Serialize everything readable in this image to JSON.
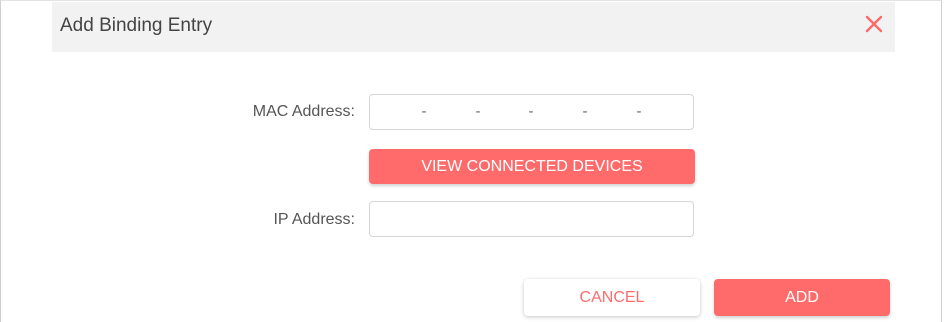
{
  "dialog": {
    "title": "Add Binding Entry",
    "close_icon": "close-icon",
    "accent_color": "#ff6b6b"
  },
  "form": {
    "mac_label": "MAC Address:",
    "mac_separators": [
      "-",
      "-",
      "-",
      "-",
      "-"
    ],
    "mac_value": "",
    "view_devices_label": "VIEW CONNECTED DEVICES",
    "ip_label": "IP Address:",
    "ip_value": ""
  },
  "actions": {
    "cancel_label": "CANCEL",
    "add_label": "ADD"
  }
}
